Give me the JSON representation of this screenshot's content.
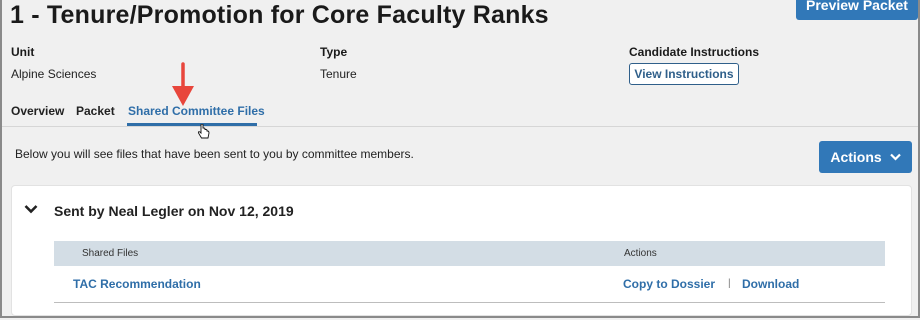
{
  "header": {
    "title": "1 - Tenure/Promotion for Core Faculty Ranks",
    "preview_button": "Preview Packet"
  },
  "meta": {
    "unit_label": "Unit",
    "unit_value": "Alpine Sciences",
    "type_label": "Type",
    "type_value": "Tenure",
    "candidate_label": "Candidate Instructions",
    "view_instructions_button": "View Instructions"
  },
  "tabs": [
    {
      "label": "Overview",
      "active": false
    },
    {
      "label": "Packet",
      "active": false
    },
    {
      "label": "Shared Committee Files",
      "active": true
    }
  ],
  "description": "Below you will see files that have been sent to you by committee members.",
  "actions_button": "Actions",
  "card": {
    "title": "Sent by Neal Legler on Nov 12, 2019",
    "columns": [
      "Shared Files",
      "Actions"
    ],
    "rows": [
      {
        "file": "TAC Recommendation",
        "action1": "Copy to Dossier",
        "separator": "|",
        "action2": "Download"
      }
    ]
  },
  "colors": {
    "primary_button": "#3178b8",
    "link": "#2f6ea8",
    "annotation_arrow": "#e8463c",
    "table_header": "#d3dde5"
  },
  "icons": [
    "red-arrow-annotation",
    "hand-cursor-icon",
    "chevron-down-icon"
  ]
}
